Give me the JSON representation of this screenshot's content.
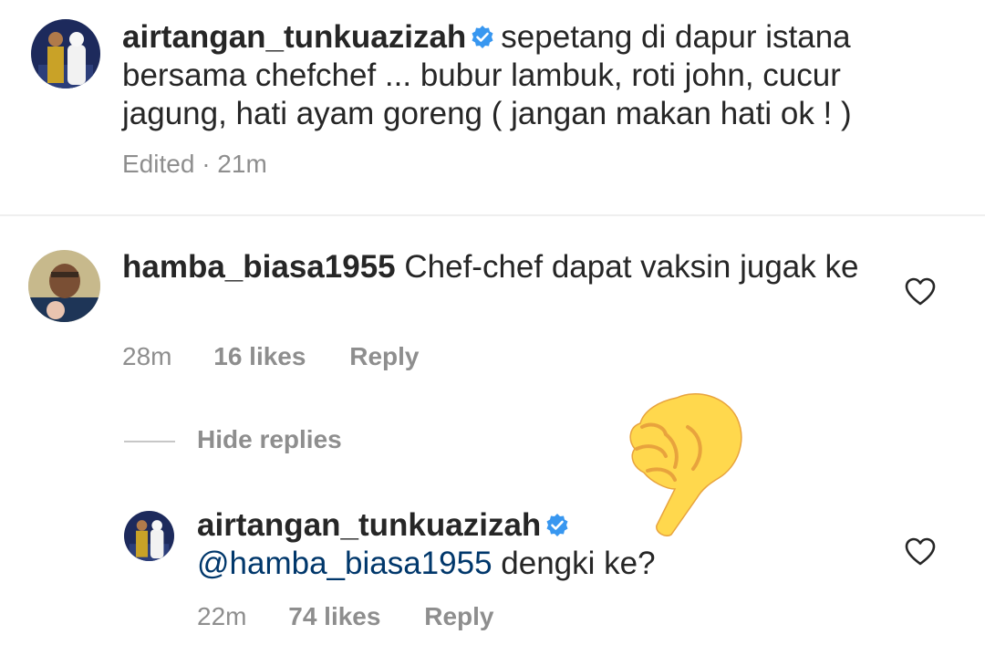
{
  "post": {
    "username": "airtangan_tunkuazizah",
    "caption": "sepetang di dapur istana bersama chefchef ... bubur lambuk, roti john, cucur jagung, hati ayam goreng ( jangan makan hati ok ! )",
    "edited_label": "Edited",
    "separator": "·",
    "time": "21m"
  },
  "comment": {
    "username": "hamba_biasa1955",
    "text": "Chef-chef dapat vaksin jugak ke",
    "time": "28m",
    "likes": "16 likes",
    "reply_label": "Reply"
  },
  "replies_toggle": {
    "label": "Hide replies"
  },
  "reply": {
    "username": "airtangan_tunkuazizah",
    "mention": "@hamba_biasa1955",
    "text": "dengki ke?",
    "time": "22m",
    "likes": "74 likes",
    "reply_label": "Reply"
  },
  "colors": {
    "verified": "#3897f0",
    "meta_text": "#8e8e8e",
    "mention": "#00376b",
    "emoji_yellow": "#ffd84d",
    "emoji_outline": "#e8a33d"
  },
  "icons": [
    "verified-badge-icon",
    "heart-icon",
    "pointing-hand-emoji"
  ]
}
